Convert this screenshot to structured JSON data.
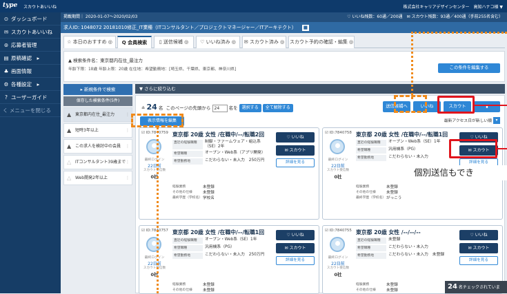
{
  "app": {
    "logo": "type",
    "logo_sub": "スカウトあいいね",
    "company": "株式会社キャリアデザインセンター　高知ハナコ様 ▼"
  },
  "sidebar": {
    "items": [
      {
        "icon": "⊙",
        "label": "ダッシュボード"
      },
      {
        "icon": "✉",
        "label": "スカウトあいいね"
      },
      {
        "icon": "⊚",
        "label": "応募者管理"
      },
      {
        "icon": "▤",
        "label": "原稿確認　▸"
      },
      {
        "icon": "♣",
        "label": "画面情報"
      },
      {
        "icon": "⚙",
        "label": "各種設定　▸"
      },
      {
        "icon": "?",
        "label": "ユーザーガイド"
      }
    ],
    "collapse": "く メニューを閉じる"
  },
  "period": {
    "label": "掲載期間｜ 2020-01-07〜2020/02/03",
    "right": "♡ いいね残数：60通／200通　✉ スカウト残数：93通／400通（手前255名含む）"
  },
  "job": {
    "title": "求人ID: 1048072 20181010修正_IT業種（ITコンサルタント／プロジェクトマネージャー／ITアーキテクト）",
    "badge": "■"
  },
  "tabs": [
    {
      "label": "☆ 本日のおすすめ ◎"
    },
    {
      "label": "Q 会員検索"
    },
    {
      "label": "▯ 送信候補 ◎"
    },
    {
      "label": "♡ いいね済み ◎"
    },
    {
      "label": "✉ スカウト済み ◎"
    },
    {
      "label": "スカウト予約の確認・編集 ◎"
    }
  ],
  "condition": {
    "name_line": "▲ 検索条件名：東京都内在住_最注力",
    "detail_line": "年齢下限：18歳 年齢上限：20歳 在住地：希望勤務地：[埼玉県、千葉県、東京都、神奈川県]",
    "edit_label": "この条件を編集する"
  },
  "left": {
    "new_cond": "▸ 新規条件で検索",
    "saved_header": "保存した検索条件(5件)",
    "saved": [
      "東京都内在住_最注力",
      "短時3年以上",
      "この求人を検討中の会員",
      "ITコンサルタント39歳まで",
      "Web開発2年以上"
    ]
  },
  "narrow": {
    "label": "▼ さらに絞り込む"
  },
  "results": {
    "count_icon": "≗",
    "count": "24",
    "unit": "名",
    "per_page_label": "このページの先頭から",
    "per_page_value": "24",
    "per_page_suffix": "名を",
    "select_btn": "選択する",
    "deselect_btn": "全て解除する",
    "display_edit": "表示情報を編集",
    "sort_label": "最新アクセス日が新しい順",
    "bulk_send": "送信候補へ",
    "like_btn": "いいね",
    "scout_btn": "スカウト",
    "extra_btn": "▮"
  },
  "cards": [
    {
      "id": "☑ ID:7840759",
      "head": "東京都 20歳 女性 /在職中/--/転職2回",
      "online": "最終ログイン",
      "date": "22日前",
      "scout_lbl": "スカウト受信数",
      "scout_cnt": "0社",
      "r1k": "直近の経験職種",
      "r1v": "制御・ファームウェア・組込系（SE）2年",
      "r2k": "希望職種",
      "r2v": "オープン・Web系（アプリ開発）",
      "r3k": "希望勤務地",
      "r3v": "こだわらない・未入力　250万円",
      "l1k": "経験業務",
      "l1v": "未登録",
      "l2k": "その他の仕様",
      "l2v": "未登録",
      "l3k": "最終学歴（学校名）",
      "l3v": "学校名",
      "like": "♡ いいね",
      "scout": "✉ スカウト",
      "detail": "詳細を見る"
    },
    {
      "id": "☑ ID:7840758",
      "head": "東京都 20歳 女性 /在職中/--/転職1回",
      "online": "最終ログイン",
      "date": "22日前",
      "scout_lbl": "スカウト受信数",
      "scout_cnt": "0社",
      "r1k": "直近の経験職種",
      "r1v": "オープン・Web系（SE）1年",
      "r2k": "希望職種",
      "r2v": "汎用機系（PG）",
      "r3k": "希望勤務地",
      "r3v": "こだわらない・未入力",
      "l1k": "経験業務",
      "l1v": "未登録",
      "l2k": "その他の仕様",
      "l2v": "未登録",
      "l3k": "最終学歴（学校名）",
      "l3v": "がっこう",
      "like": "♡ いいね",
      "scout": "✉ スカウト",
      "detail": "詳細を見る"
    },
    {
      "id": "☑ ID:7840757",
      "head": "東京都 20歳 女性 /在職中/--/転職1回",
      "online": "最終ログイン",
      "date": "22日前",
      "scout_lbl": "スカウト受信数",
      "scout_cnt": "0社",
      "r1k": "直近の経験職種",
      "r1v": "オープン・Web系（SE）1年",
      "r2k": "希望職種",
      "r2v": "汎用機系（PG）",
      "r3k": "希望勤務地",
      "r3v": "こだわらない・未入力　250万円",
      "l1k": "経験業務",
      "l1v": "未登録",
      "l2k": "その他の仕様",
      "l2v": "未登録",
      "l3k": "",
      "l3v": "",
      "like": "♡ いいね",
      "scout": "✉ スカウト",
      "detail": "詳細を見る"
    },
    {
      "id": "☑ ID:7840755",
      "head": "東京都 20歳 女性 /--/--/--",
      "online": "最終ログイン",
      "date": "22日前",
      "scout_lbl": "スカウト受信数",
      "scout_cnt": "0社",
      "r1k": "直近の経験職種",
      "r1v": "未登録",
      "r2k": "希望職種",
      "r2v": "こだわらない・未入力",
      "r3k": "希望勤務地",
      "r3v": "こだわらない・未入力　未登録",
      "l1k": "経験業務",
      "l1v": "未登録",
      "l2k": "その他の仕様",
      "l2v": "未登録",
      "l3k": "",
      "l3v": "",
      "like": "♡ いいね",
      "scout": "✉ スカウト",
      "detail": "詳細を見る"
    }
  ],
  "callout": "個別送信もでき",
  "footer": {
    "count": "24",
    "label": "名チェックされていま"
  },
  "colors": {
    "navy": "#0e3a6b",
    "accent": "#2e87d6",
    "annotation_orange": "#f08a1a",
    "annotation_red": "#e0141c"
  }
}
